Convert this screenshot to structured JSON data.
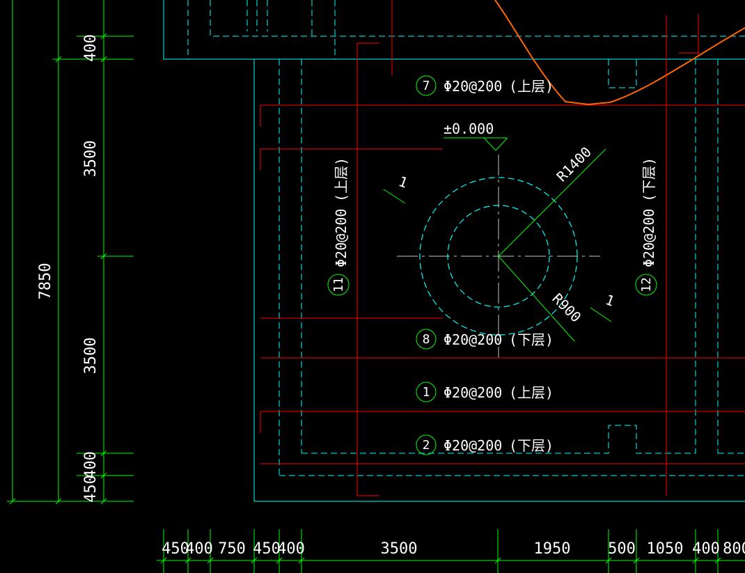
{
  "colors": {
    "background": "#000000",
    "dimension": "#00ff00",
    "concrete": "#00ffff",
    "rebar": "#ff0000",
    "slope_line": "#ff6600",
    "text": "#ffffff"
  },
  "vertical_dims": {
    "total": "7850",
    "segments": [
      "400",
      "3500",
      "3500",
      "400",
      "450"
    ]
  },
  "horizontal_dims": [
    "450",
    "400",
    "750",
    "450",
    "400",
    "3500",
    "1950",
    "500",
    "1050",
    "400",
    "800"
  ],
  "elevation": "±0.000",
  "radius_outer": "R1400",
  "radius_inner": "R900",
  "section_mark_a": "1",
  "section_mark_b": "1",
  "rebars": [
    {
      "id": "7",
      "spec": "Φ20@200",
      "layer": "(上层)"
    },
    {
      "id": "8",
      "spec": "Φ20@200",
      "layer": "(下层)"
    },
    {
      "id": "1",
      "spec": "Φ20@200",
      "layer": "(上层)"
    },
    {
      "id": "2",
      "spec": "Φ20@200",
      "layer": "(下层)"
    },
    {
      "id": "11",
      "spec": "Φ20@200",
      "layer": "(上层)"
    },
    {
      "id": "12",
      "spec": "Φ20@200",
      "layer": "(下层)"
    }
  ]
}
